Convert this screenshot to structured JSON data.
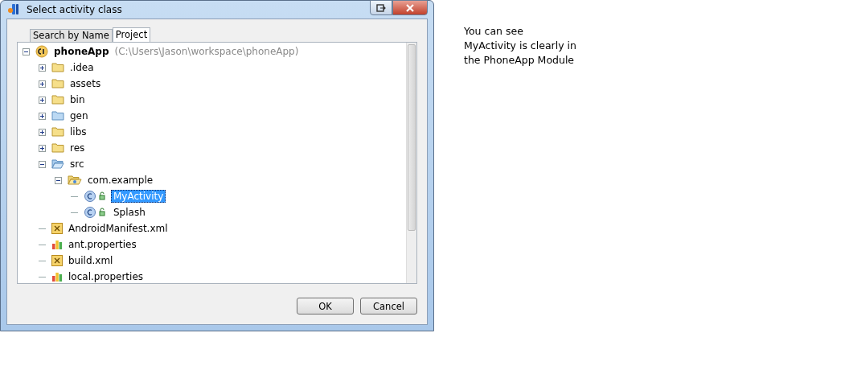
{
  "window": {
    "title": "Select activity class"
  },
  "tabs": [
    {
      "label": "Search by Name",
      "selected": false
    },
    {
      "label": "Project",
      "selected": true
    }
  ],
  "tree": [
    {
      "kind": "module",
      "label": "phoneApp",
      "detail": "(C:\\Users\\Jason\\workspace\\phoneApp)",
      "expanded": true,
      "selected": false,
      "children": [
        {
          "kind": "folder",
          "label": ".idea",
          "expanded": false,
          "selected": false
        },
        {
          "kind": "folder",
          "label": "assets",
          "expanded": false,
          "selected": false
        },
        {
          "kind": "folder",
          "label": "bin",
          "expanded": false,
          "selected": false
        },
        {
          "kind": "source-folder",
          "label": "gen",
          "expanded": false,
          "selected": false
        },
        {
          "kind": "folder",
          "label": "libs",
          "expanded": false,
          "selected": false
        },
        {
          "kind": "folder",
          "label": "res",
          "expanded": false,
          "selected": false
        },
        {
          "kind": "source-folder",
          "label": "src",
          "expanded": true,
          "selected": false,
          "children": [
            {
              "kind": "package",
              "label": "com.example",
              "expanded": true,
              "selected": false,
              "children": [
                {
                  "kind": "class",
                  "label": "MyActivity",
                  "selected": true
                },
                {
                  "kind": "class",
                  "label": "Splash",
                  "selected": false
                }
              ]
            }
          ]
        },
        {
          "kind": "xml",
          "label": "AndroidManifest.xml",
          "selected": false
        },
        {
          "kind": "properties",
          "label": "ant.properties",
          "selected": false
        },
        {
          "kind": "xml",
          "label": "build.xml",
          "selected": false
        },
        {
          "kind": "properties",
          "label": "local.properties",
          "selected": false
        }
      ]
    }
  ],
  "buttons": [
    "OK",
    "Cancel"
  ],
  "note": "You can see\nMyActivity is clearly in\nthe PhoneApp Module"
}
